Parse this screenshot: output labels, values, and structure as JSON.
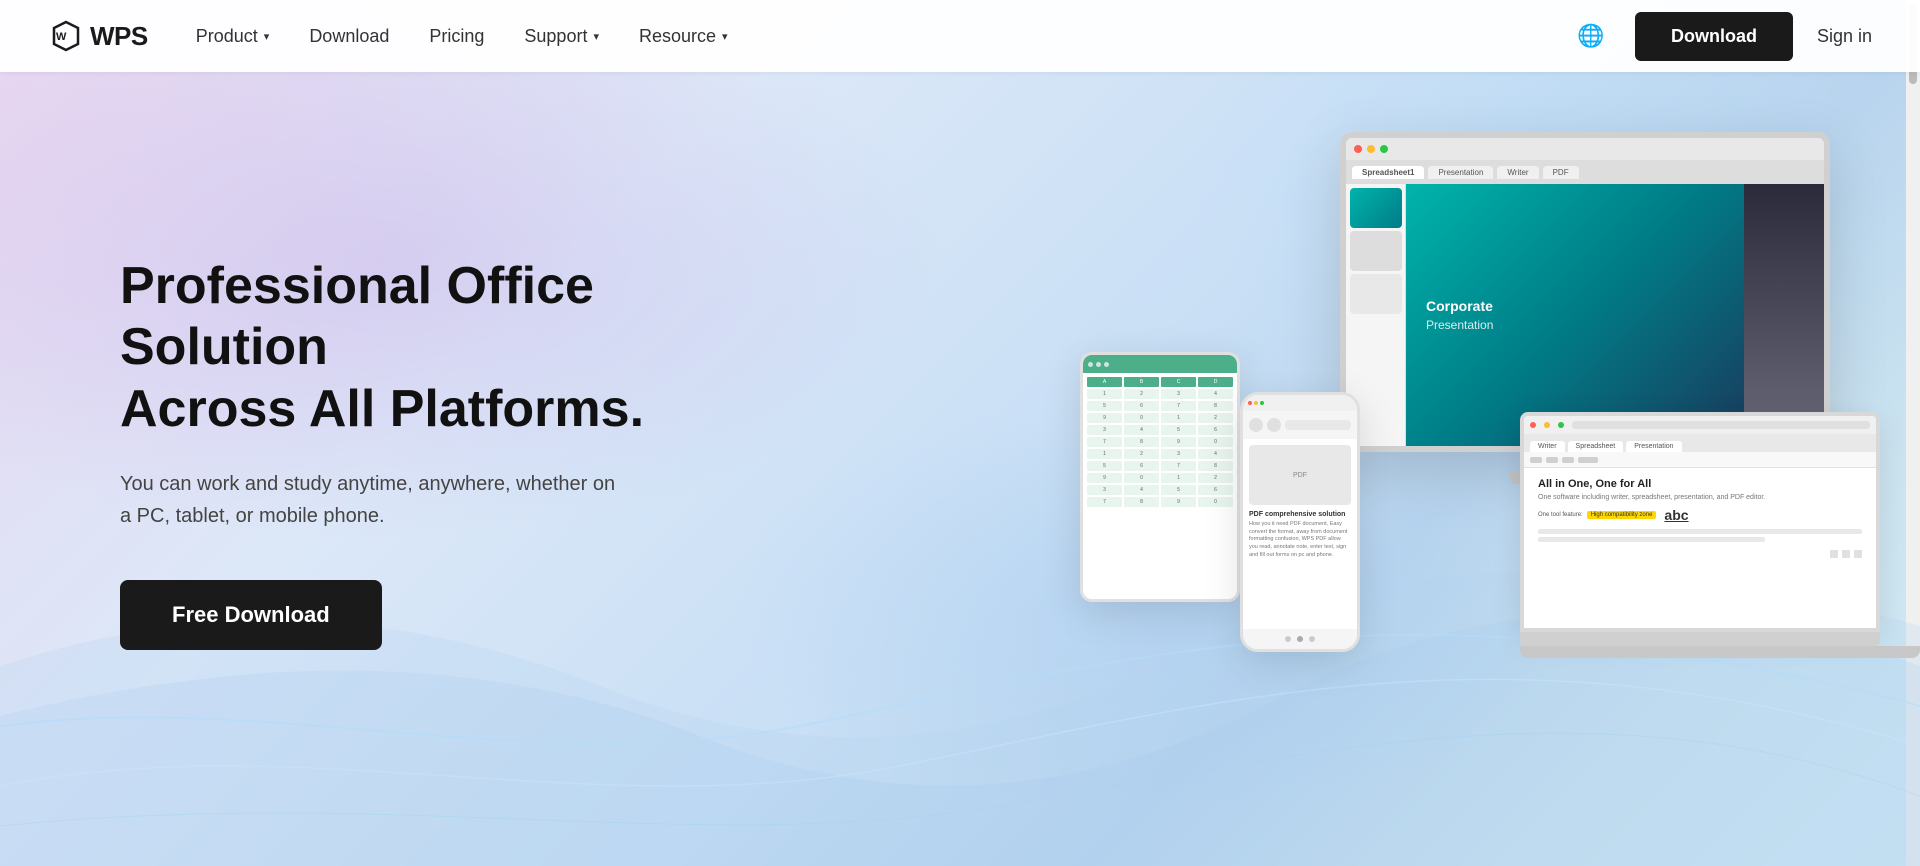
{
  "nav": {
    "logo_w": "⌂",
    "logo_text": "WPS",
    "links": [
      {
        "label": "Product",
        "has_arrow": true,
        "id": "product"
      },
      {
        "label": "Download",
        "has_arrow": false,
        "id": "download"
      },
      {
        "label": "Pricing",
        "has_arrow": false,
        "id": "pricing"
      },
      {
        "label": "Support",
        "has_arrow": true,
        "id": "support"
      },
      {
        "label": "Resource",
        "has_arrow": true,
        "id": "resource"
      }
    ],
    "globe_icon": "🌐",
    "download_btn": "Download",
    "signin": "Sign in"
  },
  "hero": {
    "title_line1": "Professional Office Solution",
    "title_line2": "Across All Platforms.",
    "subtitle": "You can work and study anytime, anywhere, whether on a PC, tablet, or mobile phone.",
    "cta": "Free Download"
  },
  "devices": {
    "monitor": {
      "presentation_title": "Corporate",
      "presentation_sub": "Presentation",
      "tabs": [
        "Spreadsheet1",
        "Presentation",
        "Writer",
        "PDF"
      ]
    },
    "laptop": {
      "title": "All in One, One for All",
      "subtitle": "One software including writer, spreadsheet, presentation, and PDF editor.",
      "highlighted_text": "High compatibility zone",
      "sample_text": "abc"
    },
    "phone": {
      "title": "PDF comprehensive solution",
      "text": "How you it need PDF document, Easy convert the format, away from document formatting confusion, WPS PDF allow you read, annotate note, enter text, sign and fill out forms on pc and phone."
    }
  }
}
